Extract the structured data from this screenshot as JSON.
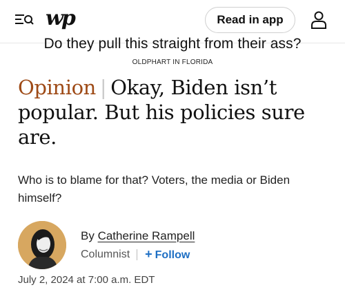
{
  "header": {
    "logo_text": "wp",
    "read_app_label": "Read in app"
  },
  "overlay": {
    "caption": "Do they pull this straight from their ass?",
    "watermark": "OLDPHART IN FLORIDA"
  },
  "article": {
    "kicker": "Opinion",
    "kicker_separator": "|",
    "headline": "Okay, Biden isn’t popular. But his policies sure are.",
    "dek": "Who is to blame for that? Voters, the media or Biden himself?",
    "byline_prefix": "By",
    "author": "Catherine Rampell",
    "role": "Columnist",
    "follow_label": "Follow",
    "follow_symbol": "+",
    "timestamp": "July 2, 2024 at 7:00 a.m. EDT"
  },
  "colors": {
    "kicker": "#9e4a16",
    "follow": "#1e6fc4",
    "avatar_bg": "#d7a760"
  },
  "icons": [
    "menu-search-icon",
    "user-icon"
  ]
}
